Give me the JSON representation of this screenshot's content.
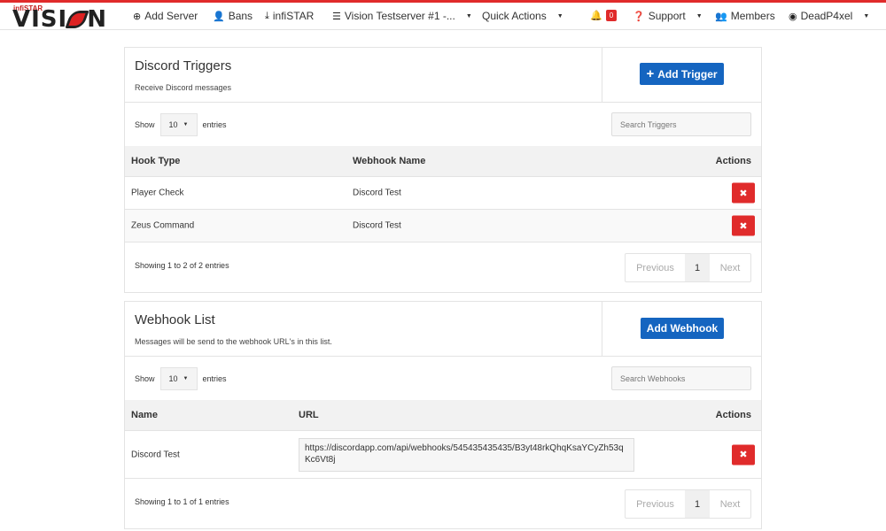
{
  "navbar": {
    "logo_small": "infiSTAR",
    "logo_big": "VISION",
    "items": [
      {
        "icon": "plus-circle-icon",
        "label": "Add Server"
      },
      {
        "icon": "user-ban-icon",
        "label": "Bans"
      },
      {
        "icon": "download-icon",
        "label": "infiSTAR"
      },
      {
        "icon": "server-icon",
        "label": "Vision Testserver #1 -..."
      },
      {
        "label": "Quick Actions"
      },
      {
        "icon": "bell-icon",
        "badge": "0"
      },
      {
        "icon": "question-circle-icon",
        "label": "Support"
      },
      {
        "icon": "users-icon",
        "label": "Members"
      },
      {
        "icon": "user-circle-icon",
        "label": "DeadP4xel"
      }
    ]
  },
  "triggers": {
    "title": "Discord Triggers",
    "subtitle": "Receive Discord messages",
    "add_button": "Add Trigger",
    "show_label": "Show",
    "page_size": "10",
    "entries_label": "entries",
    "search_placeholder": "Search Triggers",
    "columns": [
      "Hook Type",
      "Webhook Name",
      "Actions"
    ],
    "rows": [
      {
        "hook_type": "Player Check",
        "webhook_name": "Discord Test"
      },
      {
        "hook_type": "Zeus Command",
        "webhook_name": "Discord Test"
      }
    ],
    "info": "Showing 1 to 2 of 2 entries",
    "pager": {
      "prev": "Previous",
      "page": "1",
      "next": "Next"
    }
  },
  "webhooks": {
    "title": "Webhook List",
    "subtitle": "Messages will be send to the webhook URL's in this list.",
    "add_button": "Add Webhook",
    "show_label": "Show",
    "page_size": "10",
    "entries_label": "entries",
    "search_placeholder": "Search Webhooks",
    "columns": [
      "Name",
      "URL",
      "Actions"
    ],
    "rows": [
      {
        "name": "Discord Test",
        "url": "https://discordapp.com/api/webhooks/545435435435/B3yt48rkQhqKsaYCyZh53qKc6Vt8j"
      }
    ],
    "info": "Showing 1 to 1 of 1 entries",
    "pager": {
      "prev": "Previous",
      "page": "1",
      "next": "Next"
    }
  },
  "colors": {
    "accent_red": "#e02b2b",
    "primary_blue": "#1565c0"
  }
}
